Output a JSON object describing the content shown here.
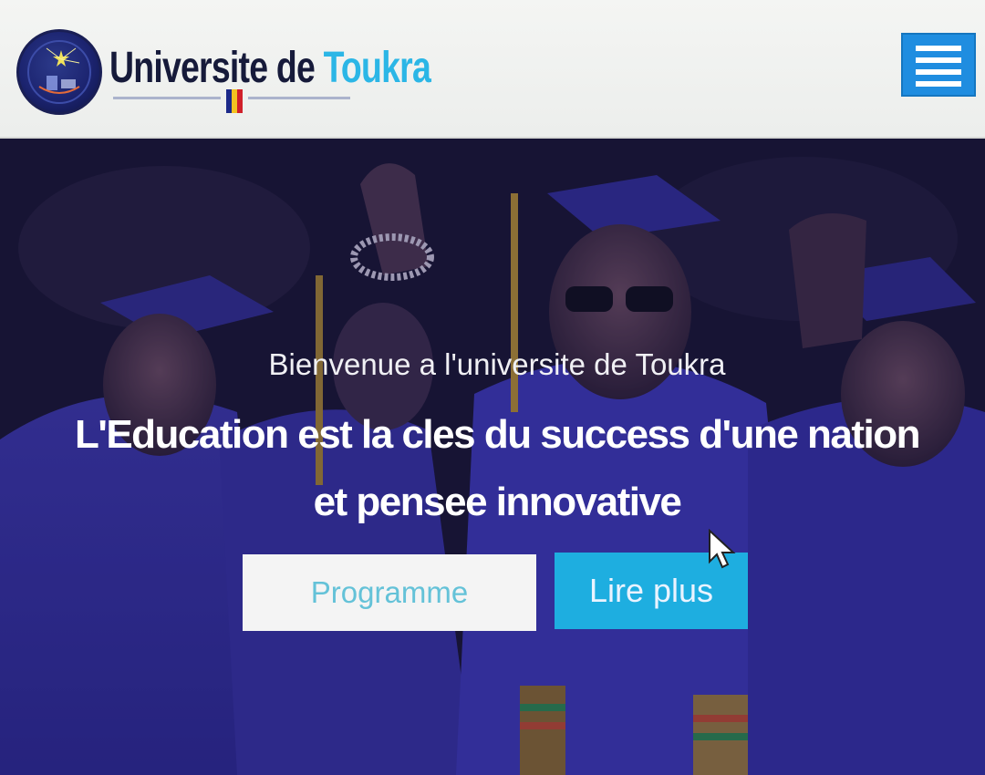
{
  "header": {
    "brand_part1": "Universite de ",
    "brand_part2": "Toukra",
    "logo_icon": "university-seal",
    "menu_icon": "hamburger-menu-icon",
    "colors": {
      "brand_dark": "#161a3a",
      "brand_accent": "#2bb6e6",
      "menu_button": "#1f8de0"
    }
  },
  "hero": {
    "welcome": "Bienvenue a l'universite de Toukra",
    "tagline": "L'Education est la cles du success d'une nation et pensee innovative",
    "buttons": {
      "programme": "Programme",
      "lire_plus": "Lire plus"
    },
    "colors": {
      "programme_bg": "#f4f4f4",
      "programme_text": "#64c2d8",
      "lire_plus_bg": "#1eaee0"
    }
  }
}
